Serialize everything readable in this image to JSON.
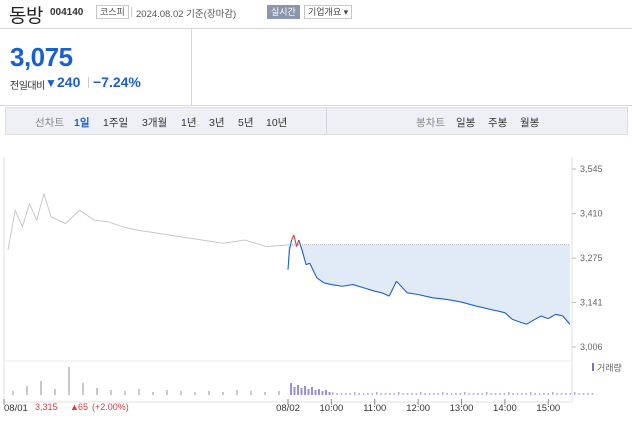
{
  "header": {
    "name": "동방",
    "code": "004140",
    "market": "코스피",
    "as_of": "2024.08.02 기준(장마감)",
    "realtime_button": "실시간",
    "company_button": "기업개요 ▾"
  },
  "quote": {
    "price": "3,075",
    "change_label": "전일대비",
    "change_arrow": "▼",
    "change_value": "240",
    "change_percent": "−7.24%"
  },
  "toolbar": {
    "line_label": "선차트",
    "line_periods": [
      "1일",
      "1주일",
      "3개월",
      "1년",
      "3년",
      "5년",
      "10년"
    ],
    "line_active": "1일",
    "candle_label": "봉차트",
    "candle_periods": [
      "일봉",
      "주봉",
      "월봉"
    ]
  },
  "colors": {
    "accent": "#1a5fd2",
    "up": "#e0383e",
    "prev_day_line": "#c8c8c8",
    "fill": "#dce8f7"
  },
  "chart_data": {
    "type": "line",
    "y_ticks": [
      "3,545",
      "3,410",
      "3,275",
      "3,141",
      "3,006"
    ],
    "ylim": [
      3006,
      3545
    ],
    "reference_price": 3315,
    "x_ticks": [
      "08/01",
      "08/02",
      "10:00",
      "11:00",
      "12:00",
      "13:00",
      "14:00",
      "15:00"
    ],
    "volume_label": "거래량",
    "prev_day_summary": {
      "date": "08/01",
      "close": "3,315",
      "arrow": "▲",
      "change": "65",
      "percent": "(+2.00%)"
    },
    "prev_day_series": {
      "x": [
        "09:00",
        "09:10",
        "09:20",
        "09:30",
        "09:40",
        "09:50",
        "10:00",
        "10:20",
        "10:40",
        "11:00",
        "11:20",
        "11:40",
        "12:00",
        "12:30",
        "13:00",
        "13:30",
        "14:00",
        "14:30",
        "15:00",
        "15:30"
      ],
      "y": [
        3300,
        3420,
        3370,
        3440,
        3390,
        3470,
        3400,
        3380,
        3420,
        3390,
        3385,
        3370,
        3360,
        3350,
        3340,
        3330,
        3320,
        3330,
        3310,
        3315
      ]
    },
    "today_series": {
      "x": [
        "09:00",
        "09:02",
        "09:05",
        "09:08",
        "09:12",
        "09:15",
        "09:20",
        "09:25",
        "09:30",
        "09:40",
        "09:50",
        "10:00",
        "10:15",
        "10:30",
        "10:45",
        "11:00",
        "11:10",
        "11:20",
        "11:30",
        "11:45",
        "12:00",
        "12:20",
        "12:40",
        "13:00",
        "13:20",
        "13:40",
        "14:00",
        "14:10",
        "14:20",
        "14:30",
        "14:40",
        "14:50",
        "15:00",
        "15:10",
        "15:20",
        "15:30"
      ],
      "y": [
        3240,
        3300,
        3330,
        3345,
        3310,
        3330,
        3295,
        3255,
        3260,
        3215,
        3200,
        3195,
        3190,
        3195,
        3185,
        3175,
        3170,
        3160,
        3205,
        3170,
        3165,
        3155,
        3150,
        3142,
        3130,
        3120,
        3110,
        3090,
        3082,
        3075,
        3088,
        3100,
        3092,
        3105,
        3100,
        3075
      ]
    }
  }
}
